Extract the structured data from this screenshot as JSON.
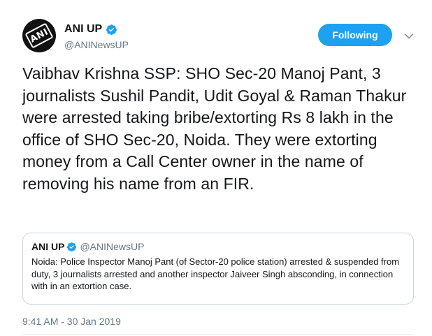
{
  "author": {
    "display_name": "ANI UP",
    "handle": "@ANINewsUP",
    "avatar_text": "ANI"
  },
  "follow_button_label": "Following",
  "tweet_text": "Vaibhav Krishna SSP: SHO Sec-20 Manoj Pant, 3 journalists Sushil Pandit, Udit Goyal & Raman Thakur were arrested taking bribe/extorting Rs 8 lakh in the office of SHO Sec-20, Noida. They were extorting money from a Call Center owner in the name of removing his name from an FIR.",
  "quoted_tweet": {
    "display_name": "ANI UP",
    "handle": "@ANINewsUP",
    "text": "Noida: Police Inspector Manoj Pant (of Sector-20 police station) arrested & suspended from duty, 3 journalists arrested and another inspector Jaiveer Singh absconding, in connection with in an extortion case."
  },
  "timestamp": "9:41 AM - 30 Jan 2019",
  "colors": {
    "accent": "#1da1f2",
    "secondary_text": "#657786",
    "border": "#ccd6dd"
  },
  "icons": [
    "verified-badge-icon",
    "chevron-down-icon"
  ]
}
